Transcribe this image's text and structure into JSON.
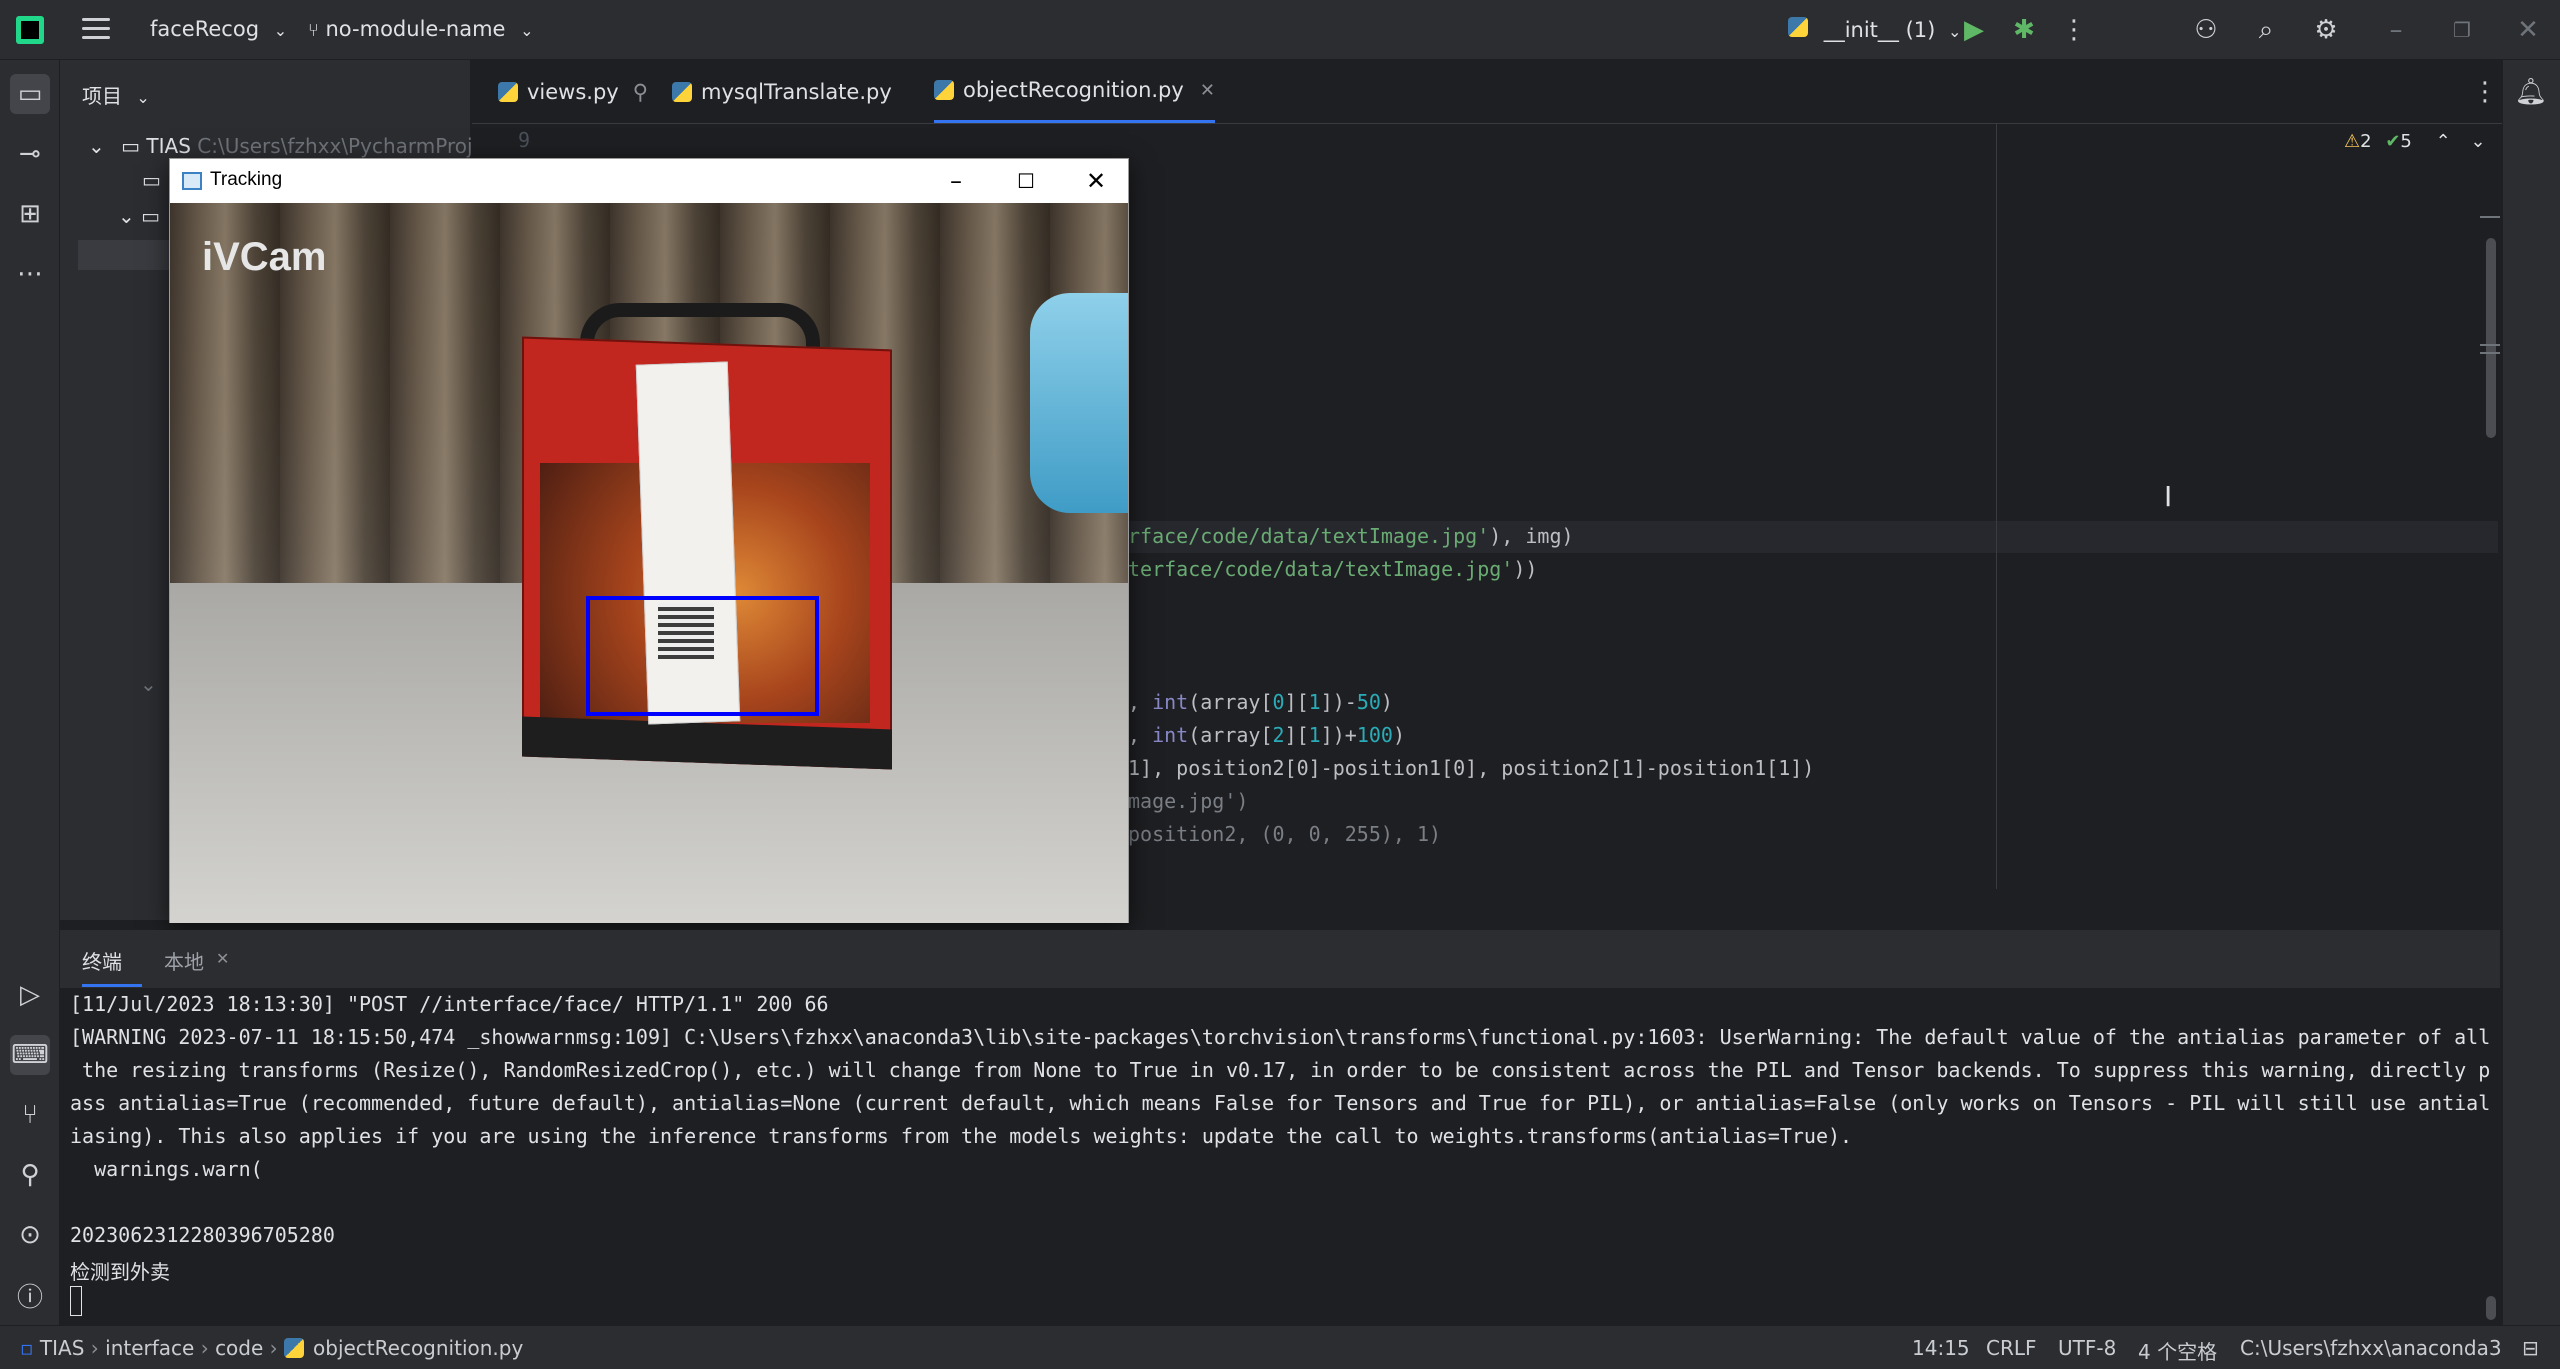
{
  "titlebar": {
    "project": "faceRecog",
    "branch": "no-module-name",
    "run_config": "__init__ (1)"
  },
  "project_panel": {
    "header": "项目",
    "root_name": "TIAS",
    "root_path": "C:\\Users\\fzhxx\\PycharmProjec"
  },
  "editor": {
    "tabs": [
      {
        "label": "views.py"
      },
      {
        "label": "mysqlTranslate.py"
      },
      {
        "label": "objectRecognition.py"
      }
    ],
    "line_number": "9",
    "inspections": {
      "warnings": "2",
      "ok": "5"
    },
    "code": {
      "l1_str": "rface/code/data/textImage.jpg'",
      "l1_tail": "), img)",
      "l2_str": "terface/code/data/textImage.jpg'",
      "l2_tail": "))",
      "l3_a": ", ",
      "l3_b": "int",
      "l3_c": "(array[",
      "l3_d": "0",
      "l3_e": "][",
      "l3_f": "1",
      "l3_g": "])-",
      "l3_h": "50",
      "l3_i": ")",
      "l4_a": ", ",
      "l4_b": "int",
      "l4_c": "(array[",
      "l4_d": "2",
      "l4_e": "][",
      "l4_f": "1",
      "l4_g": "])+",
      "l4_h": "100",
      "l4_i": ")",
      "l5": "1], position2[0]-position1[0], position2[1]-position1[1])",
      "l6": "mage.jpg')",
      "l7": "position2, (0, 0, 255), 1)"
    }
  },
  "tracking_window": {
    "title": "Tracking",
    "watermark": "iVCam"
  },
  "terminal": {
    "tabs": [
      "终端",
      "本地"
    ],
    "lines": [
      "[11/Jul/2023 18:13:30] \"POST //interface/face/ HTTP/1.1\" 200 66",
      "[WARNING 2023-07-11 18:15:50,474 _showwarnmsg:109] C:\\Users\\fzhxx\\anaconda3\\lib\\site-packages\\torchvision\\transforms\\functional.py:1603: UserWarning: The default value of the antialias parameter of all",
      " the resizing transforms (Resize(), RandomResizedCrop(), etc.) will change from None to True in v0.17, in order to be consistent across the PIL and Tensor backends. To suppress this warning, directly p",
      "ass antialias=True (recommended, future default), antialias=None (current default, which means False for Tensors and True for PIL), or antialias=False (only works on Tensors - PIL will still use antial",
      "iasing). This also applies if you are using the inference transforms from the models weights: update the call to weights.transforms(antialias=True).",
      "  warnings.warn(",
      "",
      "2023062312280396705280",
      "检测到外卖"
    ]
  },
  "statusbar": {
    "crumbs": [
      "TIAS",
      "interface",
      "code",
      "objectRecognition.py"
    ],
    "position": "14:15",
    "line_sep": "CRLF",
    "encoding": "UTF-8",
    "indent": "4 个空格",
    "interpreter": "C:\\Users\\fzhxx\\anaconda3"
  }
}
